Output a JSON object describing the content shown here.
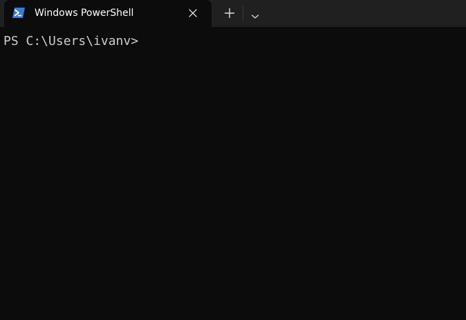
{
  "tab": {
    "title": "Windows PowerShell",
    "icon": "powershell-icon",
    "close_icon": "close-icon"
  },
  "toolbar": {
    "new_tab_icon": "plus-icon",
    "dropdown_icon": "chevron-down-icon"
  },
  "terminal": {
    "prompt": "PS C:\\Users\\ivanv>"
  },
  "colors": {
    "tabbar_bg": "#202020",
    "terminal_bg": "#0c0c0c",
    "text": "#cccccc",
    "powershell_blue": "#3a7bd5"
  }
}
